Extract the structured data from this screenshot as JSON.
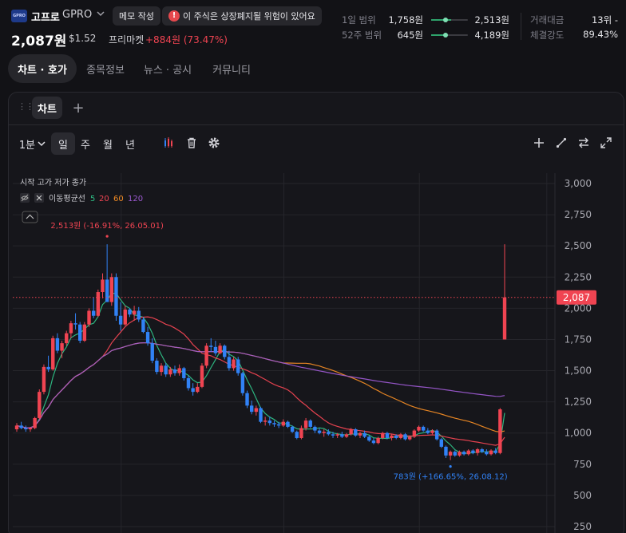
{
  "stock": {
    "logo_text": "GPRO",
    "name": "고프로",
    "ticker": "GPRO",
    "memo_button": "메모 작성",
    "warning_text": "이 주식은 상장폐지될 위험이 있어요",
    "price": "2,087원",
    "price_usd": "$1.52",
    "market": "프리마켓",
    "change": "+884원 (73.47%)"
  },
  "ranges": [
    {
      "label": "1일 범위",
      "low": "1,758원",
      "high": "2,513원",
      "fill": [
        0.0,
        0.55
      ],
      "marker": 0.4
    },
    {
      "label": "52주 범위",
      "low": "645원",
      "high": "4,189원",
      "fill": [
        0.0,
        0.38
      ],
      "marker": 0.4
    }
  ],
  "stats": [
    {
      "label": "거래대금",
      "value": "13위 -"
    },
    {
      "label": "체결강도",
      "value": "89.43%"
    }
  ],
  "tabs": [
    "차트 · 호가",
    "종목정보",
    "뉴스 · 공시",
    "커뮤니티"
  ],
  "chart_panel": {
    "tab_label": "차트",
    "interval": "1분",
    "periods": [
      "일",
      "주",
      "월",
      "년"
    ],
    "active_period": "일",
    "ohlc_legend": "시작 고가 저가 종가",
    "ma_label": "이동평균선",
    "ma_periods": [
      "5",
      "20",
      "60",
      "120"
    ],
    "ma_colors": [
      "#2ebd85",
      "#f04452",
      "#f08a24",
      "#9b59d0"
    ],
    "up_color": "#f04452",
    "down_color": "#3182f6"
  },
  "chart_data": {
    "type": "candlestick",
    "ylim": [
      250,
      3000
    ],
    "yticks": [
      3000,
      2750,
      2500,
      2250,
      2000,
      1750,
      1500,
      1250,
      1000,
      750,
      500,
      250
    ],
    "ytick_labels": [
      "3,000",
      "2,750",
      "2,500",
      "2,250",
      "2,000",
      "1,750",
      "1,500",
      "1,250",
      "1,000",
      "750",
      "500",
      "250"
    ],
    "current_price": 2087,
    "current_price_label": "2,087",
    "high_annotation": "2,513원 (-16.91%, 26.05.01)",
    "low_annotation": "783원 (+166.65%, 26.08.12)",
    "high_value": 2513,
    "low_value": 783,
    "candles": [
      [
        1030,
        1080,
        1010,
        1060
      ],
      [
        1060,
        1090,
        1030,
        1040
      ],
      [
        1040,
        1060,
        1010,
        1030
      ],
      [
        1030,
        1050,
        1010,
        1040
      ],
      [
        1040,
        1130,
        1030,
        1120
      ],
      [
        1120,
        1350,
        1110,
        1330
      ],
      [
        1330,
        1550,
        1310,
        1530
      ],
      [
        1530,
        1620,
        1490,
        1510
      ],
      [
        1510,
        1780,
        1500,
        1760
      ],
      [
        1760,
        1800,
        1640,
        1660
      ],
      [
        1660,
        1740,
        1600,
        1720
      ],
      [
        1720,
        1820,
        1700,
        1800
      ],
      [
        1800,
        1900,
        1760,
        1880
      ],
      [
        1880,
        1960,
        1830,
        1870
      ],
      [
        1870,
        1890,
        1720,
        1740
      ],
      [
        1740,
        1890,
        1730,
        1870
      ],
      [
        1870,
        2000,
        1850,
        1980
      ],
      [
        1980,
        2090,
        1920,
        1940
      ],
      [
        1940,
        2150,
        1930,
        2130
      ],
      [
        2130,
        2280,
        2080,
        2230
      ],
      [
        2230,
        2513,
        2180,
        2050
      ],
      [
        2050,
        2280,
        2020,
        2250
      ],
      [
        2250,
        2280,
        1900,
        1940
      ],
      [
        1940,
        2050,
        1820,
        1870
      ],
      [
        1870,
        2020,
        1860,
        1990
      ],
      [
        1990,
        2000,
        1930,
        1950
      ],
      [
        1950,
        2020,
        1900,
        1980
      ],
      [
        1980,
        2010,
        1890,
        1910
      ],
      [
        1910,
        1930,
        1800,
        1810
      ],
      [
        1810,
        1850,
        1700,
        1720
      ],
      [
        1720,
        1760,
        1560,
        1580
      ],
      [
        1580,
        1600,
        1470,
        1490
      ],
      [
        1490,
        1560,
        1460,
        1540
      ],
      [
        1540,
        1560,
        1450,
        1470
      ],
      [
        1470,
        1530,
        1450,
        1510
      ],
      [
        1510,
        1540,
        1460,
        1480
      ],
      [
        1480,
        1550,
        1460,
        1520
      ],
      [
        1520,
        1530,
        1420,
        1440
      ],
      [
        1440,
        1460,
        1340,
        1360
      ],
      [
        1360,
        1400,
        1300,
        1330
      ],
      [
        1330,
        1400,
        1320,
        1370
      ],
      [
        1370,
        1560,
        1360,
        1540
      ],
      [
        1540,
        1720,
        1520,
        1700
      ],
      [
        1700,
        1760,
        1650,
        1690
      ],
      [
        1690,
        1740,
        1620,
        1640
      ],
      [
        1640,
        1720,
        1630,
        1700
      ],
      [
        1700,
        1710,
        1590,
        1610
      ],
      [
        1610,
        1660,
        1500,
        1520
      ],
      [
        1520,
        1610,
        1500,
        1590
      ],
      [
        1590,
        1610,
        1460,
        1480
      ],
      [
        1480,
        1490,
        1300,
        1320
      ],
      [
        1320,
        1340,
        1200,
        1220
      ],
      [
        1220,
        1260,
        1150,
        1170
      ],
      [
        1170,
        1220,
        1140,
        1200
      ],
      [
        1200,
        1210,
        1080,
        1090
      ],
      [
        1090,
        1130,
        1060,
        1100
      ],
      [
        1100,
        1130,
        1060,
        1080
      ],
      [
        1080,
        1100,
        1050,
        1070
      ],
      [
        1070,
        1090,
        1040,
        1060
      ],
      [
        1060,
        1110,
        1050,
        1090
      ],
      [
        1090,
        1100,
        1040,
        1050
      ],
      [
        1050,
        1060,
        1000,
        1010
      ],
      [
        1010,
        1020,
        950,
        960
      ],
      [
        960,
        1060,
        950,
        1040
      ],
      [
        1040,
        1120,
        1020,
        1100
      ],
      [
        1100,
        1110,
        1040,
        1050
      ],
      [
        1050,
        1060,
        1000,
        1020
      ],
      [
        1020,
        1040,
        990,
        1000
      ],
      [
        1000,
        1030,
        970,
        1010
      ],
      [
        1010,
        1030,
        980,
        990
      ],
      [
        990,
        1010,
        960,
        980
      ],
      [
        980,
        1000,
        960,
        990
      ],
      [
        990,
        1010,
        960,
        970
      ],
      [
        970,
        1000,
        960,
        990
      ],
      [
        990,
        1040,
        980,
        1030
      ],
      [
        1030,
        1040,
        970,
        980
      ],
      [
        980,
        1010,
        960,
        1000
      ],
      [
        1000,
        1020,
        960,
        970
      ],
      [
        970,
        980,
        930,
        940
      ],
      [
        940,
        960,
        910,
        920
      ],
      [
        920,
        970,
        910,
        960
      ],
      [
        960,
        1010,
        950,
        1000
      ],
      [
        1000,
        1010,
        950,
        960
      ],
      [
        960,
        990,
        940,
        980
      ],
      [
        980,
        990,
        950,
        960
      ],
      [
        960,
        1000,
        950,
        990
      ],
      [
        990,
        1000,
        940,
        950
      ],
      [
        950,
        980,
        940,
        970
      ],
      [
        970,
        1030,
        960,
        1020
      ],
      [
        1020,
        1060,
        1010,
        1050
      ],
      [
        1050,
        1060,
        1010,
        1020
      ],
      [
        1020,
        1040,
        990,
        1000
      ],
      [
        1000,
        1030,
        990,
        1020
      ],
      [
        1020,
        1030,
        940,
        950
      ],
      [
        950,
        960,
        880,
        890
      ],
      [
        890,
        900,
        800,
        820
      ],
      [
        820,
        860,
        783,
        850
      ],
      [
        850,
        860,
        810,
        820
      ],
      [
        820,
        860,
        810,
        850
      ],
      [
        850,
        860,
        820,
        830
      ],
      [
        830,
        870,
        820,
        860
      ],
      [
        860,
        870,
        830,
        840
      ],
      [
        840,
        880,
        820,
        870
      ],
      [
        870,
        880,
        840,
        850
      ],
      [
        850,
        870,
        820,
        830
      ],
      [
        830,
        870,
        820,
        860
      ],
      [
        860,
        880,
        830,
        840
      ],
      [
        840,
        1200,
        830,
        1190
      ],
      [
        1750,
        2513,
        1750,
        2087
      ]
    ]
  }
}
